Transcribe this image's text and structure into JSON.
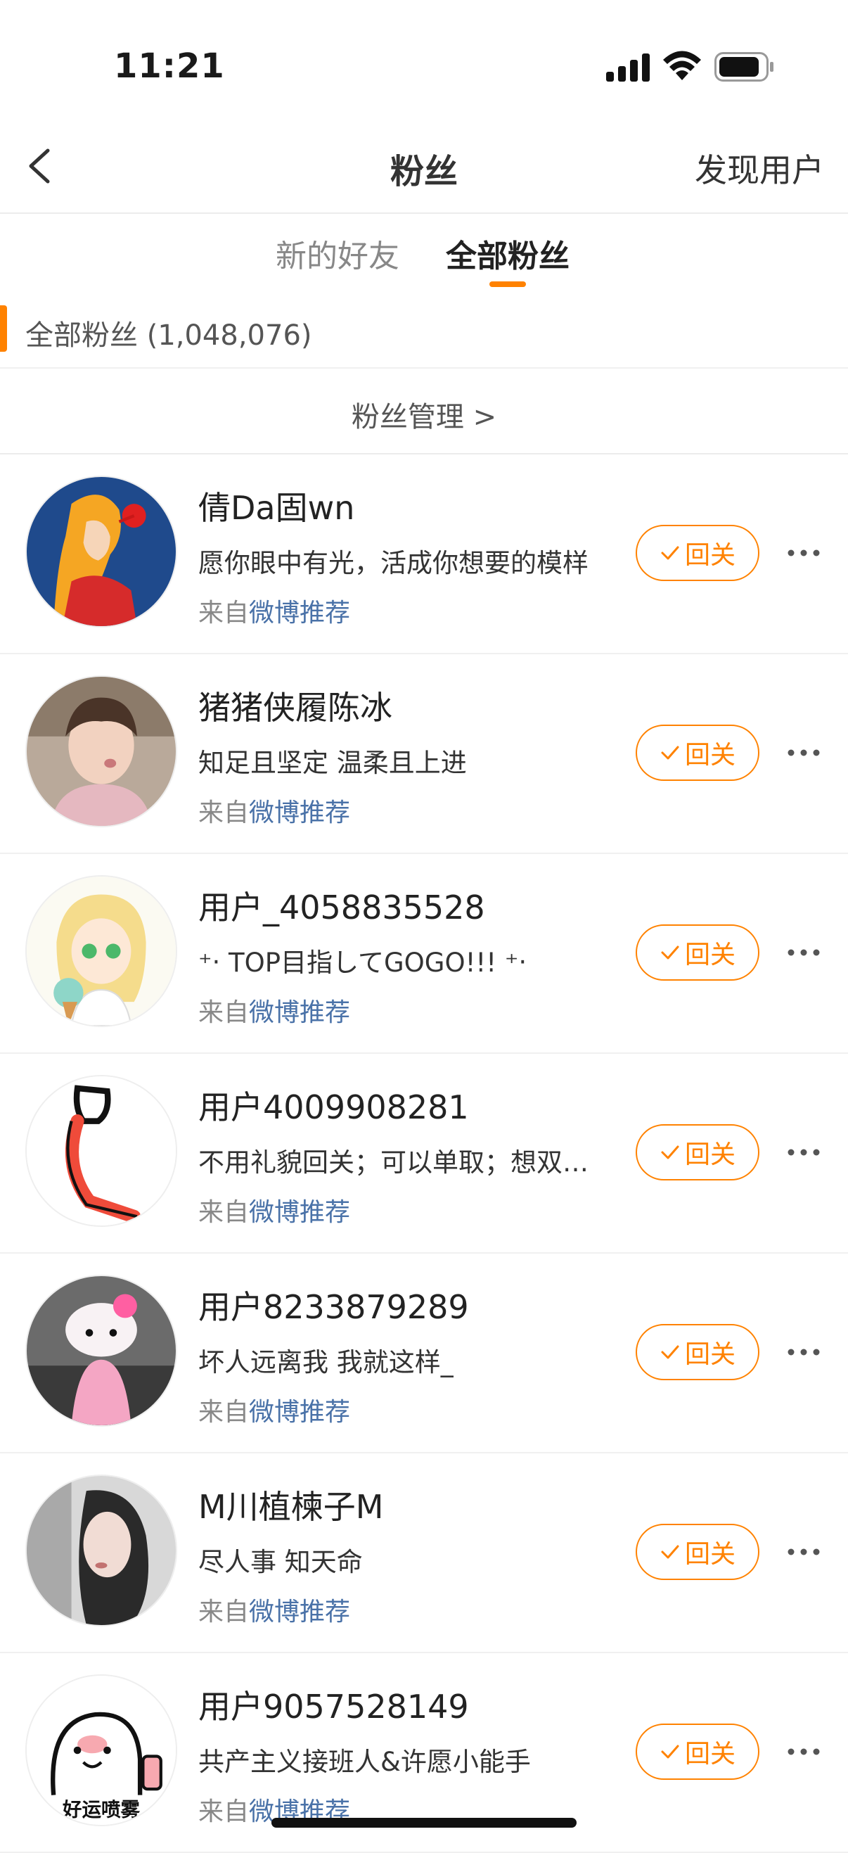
{
  "status_bar": {
    "time": "11:21"
  },
  "nav": {
    "title": "粉丝",
    "right_action": "发现用户"
  },
  "tabs": [
    {
      "label": "新的好友"
    },
    {
      "label": "全部粉丝"
    }
  ],
  "section": {
    "label": "全部粉丝 (1,048,076)"
  },
  "manage": {
    "label": "粉丝管理  >"
  },
  "follow_label": "回关",
  "source_prefix": "来自",
  "source_link": "微博推荐",
  "fans": [
    {
      "name": "倩Da固wn",
      "bio": "愿你眼中有光，活成你想要的模样"
    },
    {
      "name": "猪猪侠履陈冰",
      "bio": "知足且坚定 温柔且上进"
    },
    {
      "name": "用户_4058835528",
      "bio": "⁺‧ TOP目指してGOGO!!! ⁺‧"
    },
    {
      "name": "用户4009908281",
      "bio": "不用礼貌回关；可以单取；想双关的话"
    },
    {
      "name": "用户8233879289",
      "bio": "坏人远离我 我就这样_"
    },
    {
      "name": "M川植楝子M",
      "bio": "尽人事 知天命"
    },
    {
      "name": "用户9057528149",
      "bio": "共产主义接班人&许愿小能手"
    }
  ],
  "avatar_7_text": "好运喷雾",
  "colors": {
    "accent": "#ff8200",
    "link": "#4a72a8"
  }
}
